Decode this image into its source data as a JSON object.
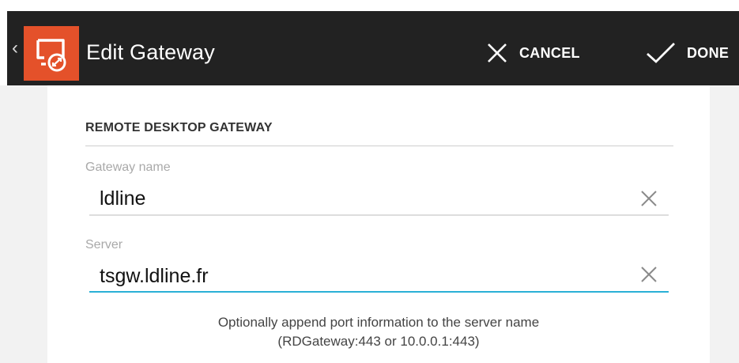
{
  "header": {
    "title": "Edit Gateway",
    "cancel_label": "CANCEL",
    "done_label": "DONE",
    "back_glyph": "‹"
  },
  "section": {
    "title": "REMOTE DESKTOP GATEWAY"
  },
  "fields": {
    "gateway_name": {
      "label": "Gateway name",
      "value": "ldline"
    },
    "server": {
      "label": "Server",
      "value": "tsgw.ldline.fr"
    }
  },
  "hint": {
    "line1": "Optionally append port information to the server name",
    "line2": "(RDGateway:443 or 10.0.0.1:443)"
  },
  "icons": {
    "app_logo": "remote-desktop-app-icon",
    "cancel": "close-icon",
    "done": "checkmark-icon",
    "clear": "clear-x-icon"
  },
  "colors": {
    "action_bar": "#222222",
    "app_logo_bg": "#e4512a",
    "focus_underline": "#2ab0d6"
  }
}
